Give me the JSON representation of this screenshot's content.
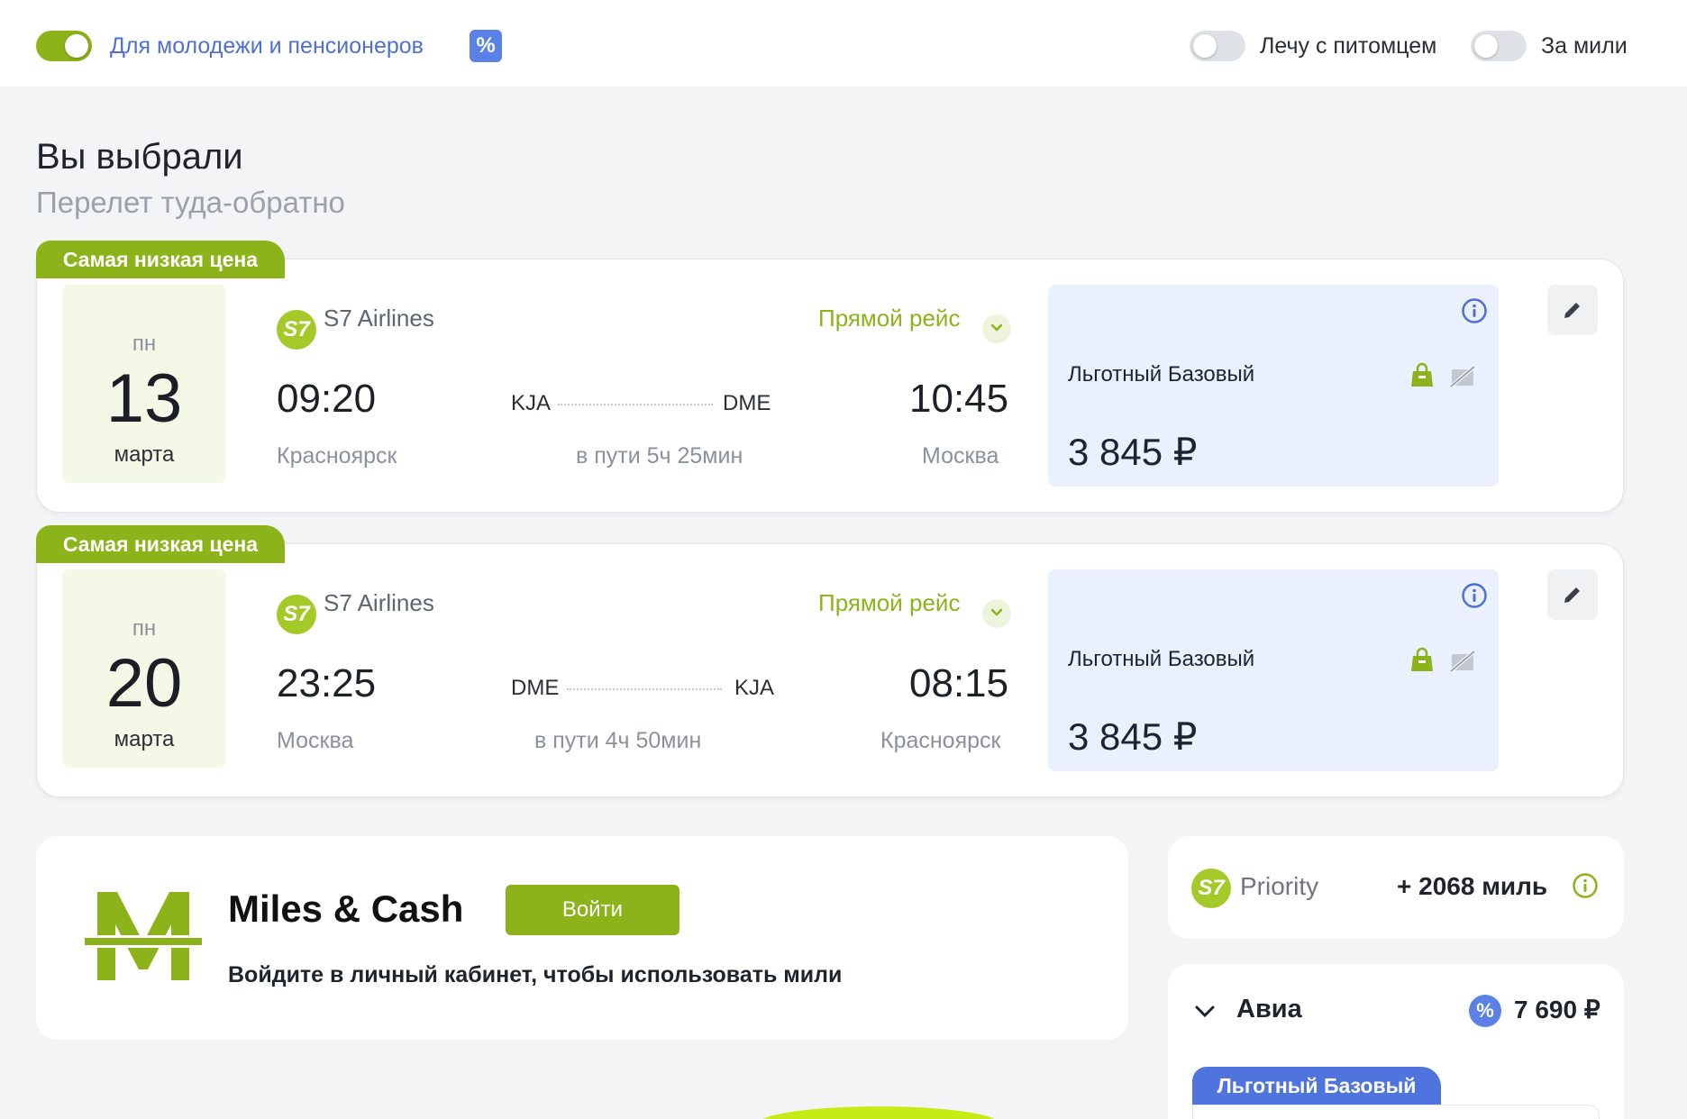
{
  "topbar": {
    "youth_label": "Для молодежи и пенсионеров",
    "youth_badge": "%",
    "pet_label": "Лечу с питомцем",
    "miles_label": "За мили",
    "youth_toggle_on": true,
    "pet_toggle_on": false,
    "miles_toggle_on": false
  },
  "heading": {
    "title": "Вы выбрали",
    "subtitle": "Перелет туда-обратно"
  },
  "flights": [
    {
      "tag": "Самая низкая цена",
      "dow": "пн",
      "day": "13",
      "month": "марта",
      "airline_logo": "S7",
      "airline": "S7 Airlines",
      "direct": "Прямой рейс",
      "dep_time": "09:20",
      "dep_code": "KJA",
      "arr_code": "DME",
      "arr_time": "10:45",
      "dep_city": "Красноярск",
      "duration": "в пути 5ч 25мин",
      "arr_city": "Москва",
      "fare_name": "Льготный Базовый",
      "price": "3 845 ₽"
    },
    {
      "tag": "Самая низкая цена",
      "dow": "пн",
      "day": "20",
      "month": "марта",
      "airline_logo": "S7",
      "airline": "S7 Airlines",
      "direct": "Прямой рейс",
      "dep_time": "23:25",
      "dep_code": "DME",
      "arr_code": "KJA",
      "arr_time": "08:15",
      "dep_city": "Москва",
      "duration": "в пути 4ч 50мин",
      "arr_city": "Красноярск",
      "fare_name": "Льготный Базовый",
      "price": "3 845 ₽"
    }
  ],
  "miles_cash": {
    "logo": "M",
    "title": "Miles & Cash",
    "login": "Войти",
    "subtitle": "Войдите в личный кабинет, чтобы использовать мили"
  },
  "priority": {
    "logo": "S7",
    "label": "Priority",
    "miles": "+ 2068 миль"
  },
  "avia": {
    "title": "Авиа",
    "badge": "%",
    "total": "7 690 ₽",
    "fare_tag": "Льготный Базовый"
  },
  "colors": {
    "accent_green": "#8cb31a",
    "accent_blue": "#5a82e6",
    "fare_bg": "#eaf0fd",
    "date_bg": "#f4f8e7"
  },
  "icons": [
    "percent-icon",
    "chevron-down-icon",
    "info-icon",
    "baggage-icon",
    "no-baggage-icon",
    "edit-icon"
  ]
}
